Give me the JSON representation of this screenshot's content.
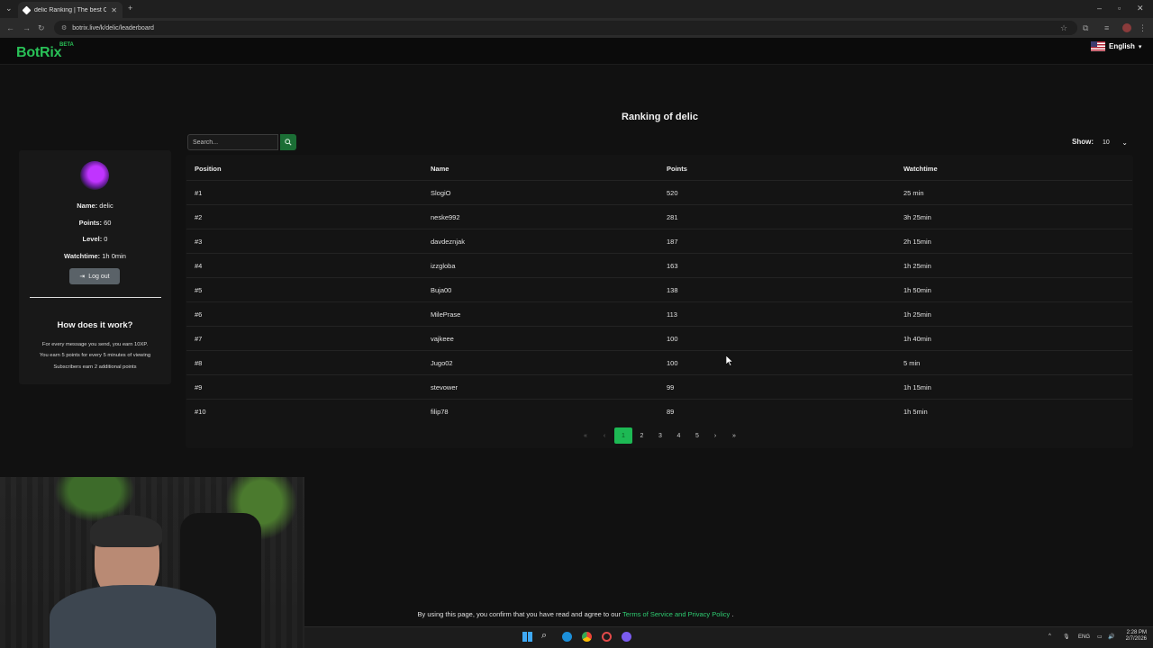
{
  "browser": {
    "tab_title": "delic Ranking | The best ChatB...",
    "url": "botrix.live/k/delic/leaderboard"
  },
  "site": {
    "logo": "BotRix",
    "beta": "BETA",
    "language": "English"
  },
  "page": {
    "title": "Ranking of delic"
  },
  "user_card": {
    "name_label": "Name:",
    "name": "delic",
    "points_label": "Points:",
    "points": "60",
    "level_label": "Level:",
    "level": "0",
    "watchtime_label": "Watchtime:",
    "watchtime": "1h 0min",
    "logout_label": "Log out",
    "how_title": "How does it work?",
    "how_lines": [
      "For every message you send, you earn 10XP.",
      "You earn 5 points for every 5 minutes of viewing",
      "Subscribers earn 2 additional points"
    ]
  },
  "controls": {
    "search_placeholder": "Search...",
    "show_label": "Show:",
    "show_value": "10"
  },
  "table": {
    "headers": [
      "Position",
      "Name",
      "Points",
      "Watchtime"
    ],
    "rows": [
      {
        "position": "#1",
        "name": "SlogiO",
        "points": "520",
        "watchtime": "25 min"
      },
      {
        "position": "#2",
        "name": "neske992",
        "points": "281",
        "watchtime": "3h 25min"
      },
      {
        "position": "#3",
        "name": "davdeznjak",
        "points": "187",
        "watchtime": "2h 15min"
      },
      {
        "position": "#4",
        "name": "izzgloba",
        "points": "163",
        "watchtime": "1h 25min"
      },
      {
        "position": "#5",
        "name": "Buja00",
        "points": "138",
        "watchtime": "1h 50min"
      },
      {
        "position": "#6",
        "name": "MilePrase",
        "points": "113",
        "watchtime": "1h 25min"
      },
      {
        "position": "#7",
        "name": "vajkeee",
        "points": "100",
        "watchtime": "1h 40min"
      },
      {
        "position": "#8",
        "name": "Jugo02",
        "points": "100",
        "watchtime": "5 min"
      },
      {
        "position": "#9",
        "name": "stevower",
        "points": "99",
        "watchtime": "1h 15min"
      },
      {
        "position": "#10",
        "name": "filip78",
        "points": "89",
        "watchtime": "1h 5min"
      }
    ]
  },
  "pagination": {
    "first": "«",
    "prev": "‹",
    "pages": [
      "1",
      "2",
      "3",
      "4",
      "5"
    ],
    "next": "›",
    "last": "»",
    "current": "1"
  },
  "footer": {
    "text_before": "By using this page, you confirm that you have read and agree to our",
    "link": "Terms of Service and Privacy Policy",
    "text_after": "."
  },
  "taskbar": {
    "lang": "ENG",
    "time": "2:28 PM",
    "date": "2/7/2026"
  },
  "colors": {
    "brand_green": "#29c157",
    "active_page": "#1db954",
    "background": "#111111"
  }
}
